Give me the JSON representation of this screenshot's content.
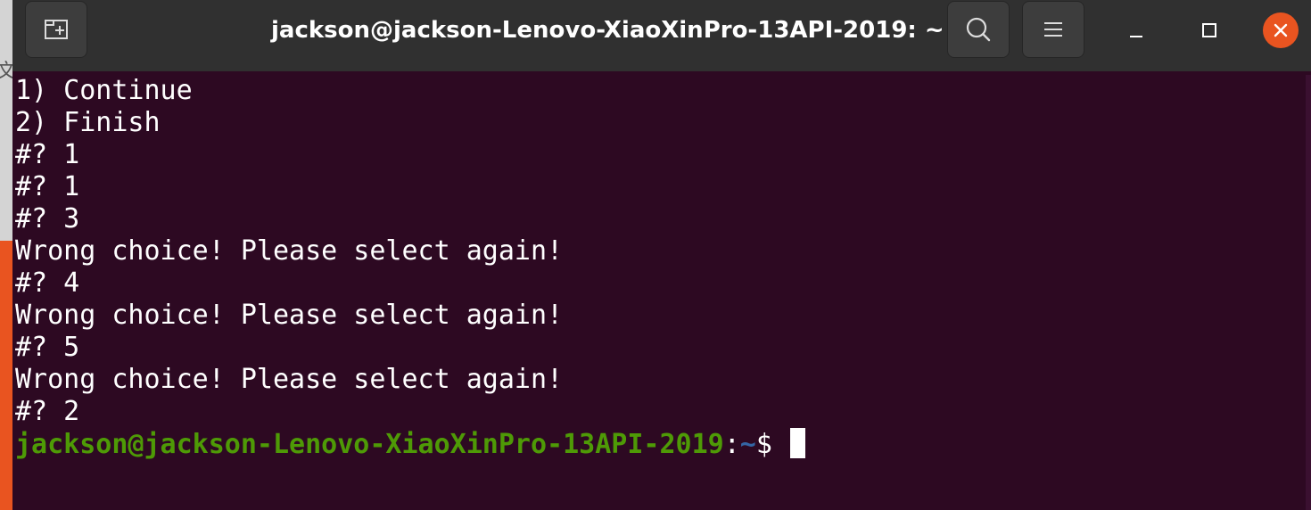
{
  "window": {
    "title": "jackson@jackson-Lenovo-XiaoXinPro-13API-2019: ~"
  },
  "desktop": {
    "edge_glyph": "文"
  },
  "terminal": {
    "lines": [
      "1) Continue",
      "2) Finish",
      "#? 1",
      "#? 1",
      "#? 3",
      "Wrong choice! Please select again!",
      "#? 4",
      "Wrong choice! Please select again!",
      "#? 5",
      "Wrong choice! Please select again!",
      "#? 2"
    ],
    "prompt": {
      "user_host": "jackson@jackson-Lenovo-XiaoXinPro-13API-2019",
      "colon": ":",
      "path": "~",
      "dollar": "$ "
    },
    "colors": {
      "background": "#2d0922",
      "prompt_user": "#4e9a06",
      "prompt_path": "#3465a4",
      "text": "#ffffff"
    }
  },
  "icons": {
    "new_tab": "new-tab-icon",
    "search": "search-icon",
    "menu": "hamburger-menu-icon",
    "minimize": "minimize-icon",
    "maximize": "maximize-icon",
    "close": "close-icon"
  }
}
